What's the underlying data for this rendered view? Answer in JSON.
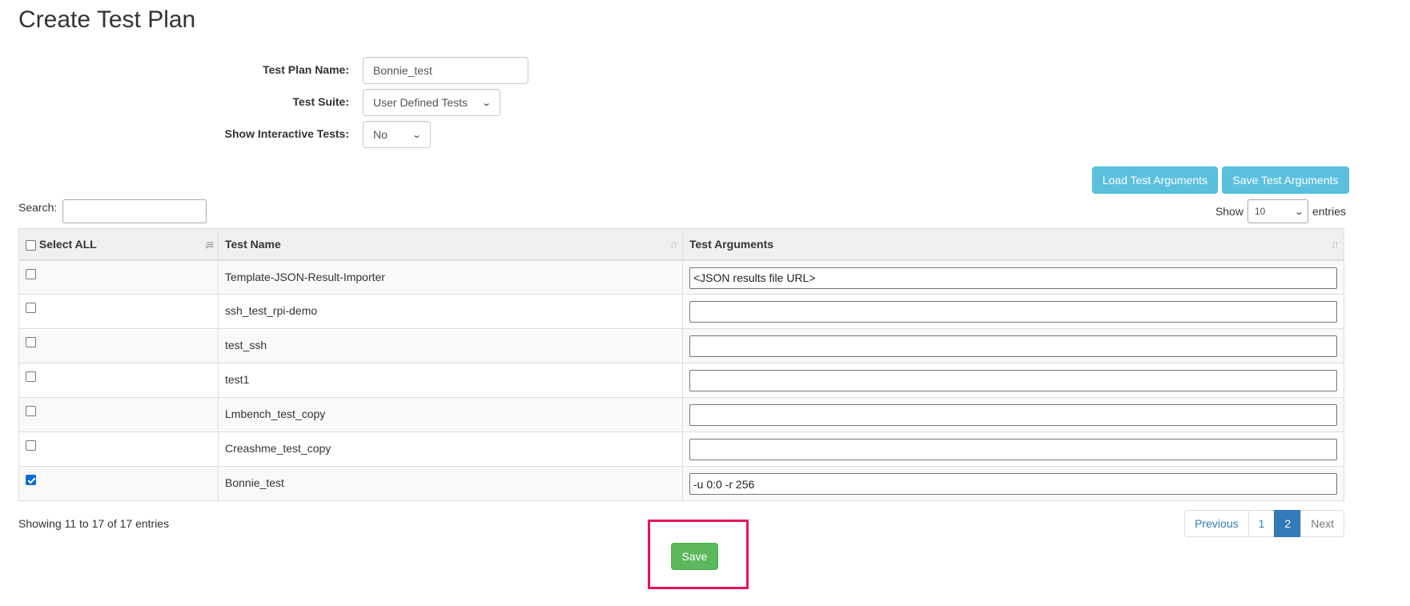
{
  "page": {
    "title": "Create Test Plan"
  },
  "form": {
    "plan_name_label": "Test Plan Name:",
    "plan_name_value": "Bonnie_test",
    "suite_label": "Test Suite:",
    "suite_value": "User Defined Tests",
    "interactive_label": "Show Interactive Tests:",
    "interactive_value": "No"
  },
  "toolbar": {
    "load_label": "Load Test Arguments",
    "save_args_label": "Save Test Arguments"
  },
  "table_controls": {
    "search_label": "Search:",
    "show_label": "Show",
    "show_value": "10",
    "entries_label": "entries"
  },
  "table": {
    "columns": [
      "Select ALL",
      "Test Name",
      "Test Arguments"
    ],
    "rows": [
      {
        "checked": false,
        "name": "Template-JSON-Result-Importer",
        "args": "<JSON results file URL>"
      },
      {
        "checked": false,
        "name": "ssh_test_rpi-demo",
        "args": ""
      },
      {
        "checked": false,
        "name": "test_ssh",
        "args": ""
      },
      {
        "checked": false,
        "name": "test1",
        "args": ""
      },
      {
        "checked": false,
        "name": "Lmbench_test_copy",
        "args": ""
      },
      {
        "checked": false,
        "name": "Creashme_test_copy",
        "args": ""
      },
      {
        "checked": true,
        "name": "Bonnie_test",
        "args": "-u 0:0 -r 256"
      }
    ]
  },
  "footer": {
    "info": "Showing 11 to 17 of 17 entries",
    "pager": {
      "previous": "Previous",
      "page1": "1",
      "page2": "2",
      "next": "Next"
    },
    "save_label": "Save"
  },
  "colors": {
    "info_button": "#5bc0de",
    "save_button": "#5cb85c",
    "active_page": "#337ab7",
    "highlight": "#e8145a"
  }
}
